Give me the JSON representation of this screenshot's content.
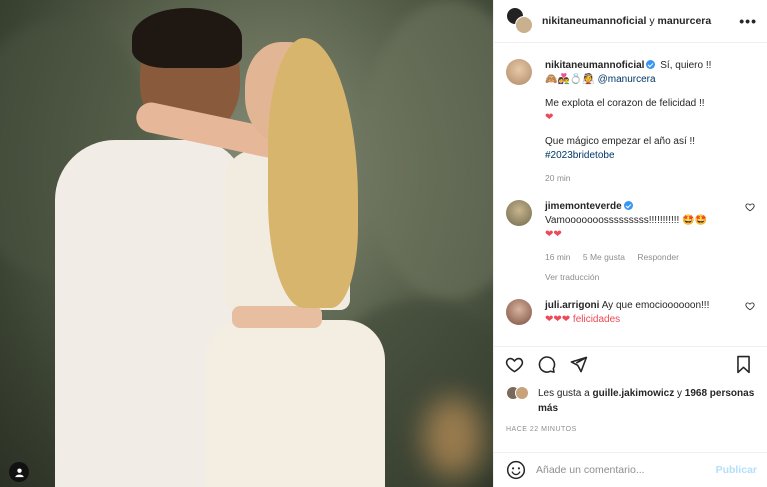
{
  "header": {
    "user1": "nikitaneumannoficial",
    "conj": "y",
    "user2": "manurcera",
    "more": "•••"
  },
  "caption": {
    "user": "nikitaneumannoficial",
    "text_line1": "Sí, quiero !!",
    "emoji_line": "🙈👩‍❤️‍👨💍👰",
    "mention": "@manurcera",
    "para2": "Me explota el corazon de felicidad !!",
    "heart2": "❤",
    "para3": "Que mágico empezar el año así !!",
    "hashtag": "#2023bridetobe",
    "time": "20 min"
  },
  "comments": [
    {
      "user": "jimemonteverde",
      "text": "Vamooooooosssssssss!!!!!!!!!!!",
      "emoji": "🤩🤩",
      "hearts": "❤❤",
      "time": "16 min",
      "likes": "5 Me gusta",
      "reply": "Responder",
      "view_replies": "Ver traducción"
    },
    {
      "user": "juli.arrigoni",
      "text": "Ay que emocioooooon!!!",
      "extra": "❤❤❤ felicidades"
    }
  ],
  "likes": {
    "prefix": "Les gusta a",
    "user": "guille.jakimowicz",
    "mid": "y",
    "count": "1968 personas más"
  },
  "timestamp": "HACE 22 MINUTOS",
  "comment_box": {
    "placeholder": "Añade un comentario...",
    "publish": "Publicar"
  }
}
